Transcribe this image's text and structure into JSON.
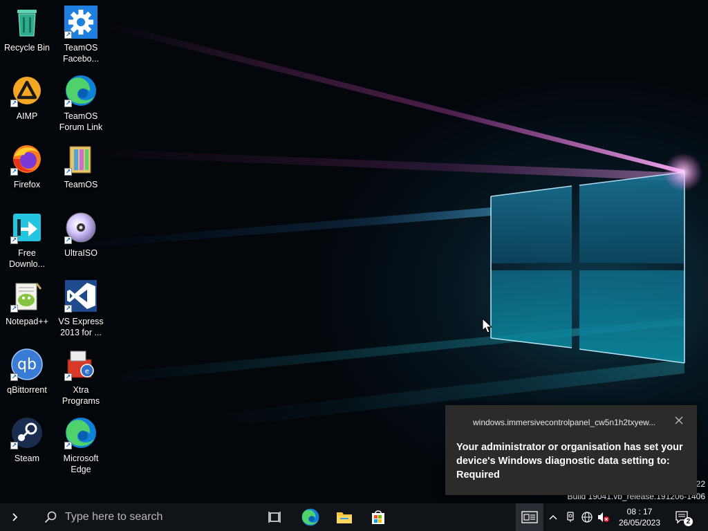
{
  "desktop": {
    "icons": [
      {
        "label": "Recycle Bin",
        "icon": "recycle-bin-icon"
      },
      {
        "label": "TeamOS Facebo...",
        "icon": "gear-icon"
      },
      {
        "label": "AIMP",
        "icon": "aimp-icon"
      },
      {
        "label": "TeamOS Forum Link",
        "icon": "edge-icon"
      },
      {
        "label": "Firefox",
        "icon": "firefox-icon"
      },
      {
        "label": "TeamOS",
        "icon": "teamos-icon"
      },
      {
        "label": "Free Downlo...",
        "icon": "download-arrow-icon"
      },
      {
        "label": "UltraISO",
        "icon": "disc-icon"
      },
      {
        "label": "Notepad++",
        "icon": "notepad-icon"
      },
      {
        "label": "VS Express 2013 for ...",
        "icon": "visual-studio-icon"
      },
      {
        "label": "qBittorrent",
        "icon": "qbittorrent-icon"
      },
      {
        "label": "Xtra Programs",
        "icon": "toolbox-icon"
      },
      {
        "label": "Steam",
        "icon": "steam-icon"
      },
      {
        "label": "Microsoft Edge",
        "icon": "edge-icon"
      }
    ]
  },
  "watermark": {
    "line1": "22",
    "line2": "Build 19041.vb_release.191206-1406"
  },
  "notification": {
    "app_name": "windows.immersivecontrolpanel_cw5n1h2txyew...",
    "message": "Your administrator or organisation has set your device's Windows diagnostic data setting to: Required"
  },
  "taskbar": {
    "search_placeholder": "Type here to search",
    "time": "08 : 17",
    "date": "26/05/2023",
    "notification_count": "2"
  },
  "colors": {
    "taskbar_bg": "#101318",
    "toast_bg": "#2b2b2b",
    "edge_blue": "#0f7fd8",
    "edge_green": "#4fd16b"
  }
}
